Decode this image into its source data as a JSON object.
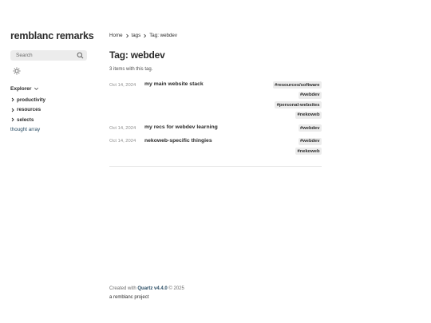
{
  "site": {
    "title": "remblanc remarks"
  },
  "search": {
    "placeholder": "Search"
  },
  "explorer": {
    "title": "Explorer",
    "items": [
      {
        "label": "productivity",
        "type": "folder"
      },
      {
        "label": "resources",
        "type": "folder"
      },
      {
        "label": "selects",
        "type": "folder"
      },
      {
        "label": "thought array",
        "type": "file"
      }
    ]
  },
  "breadcrumb": {
    "home": "Home",
    "tags": "tags",
    "current": "Tag: webdev"
  },
  "page": {
    "title": "Tag: webdev",
    "count_text": "3 items with this tag."
  },
  "posts": [
    {
      "date": "Oct 14, 2024",
      "title": "my main website stack",
      "tags": [
        "#resources/software",
        "#webdev",
        "#personal-websites",
        "#nekoweb"
      ]
    },
    {
      "date": "Oct 14, 2024",
      "title": "my recs for webdev learning",
      "tags": [
        "#webdev"
      ]
    },
    {
      "date": "Oct 14, 2024",
      "title": "nekoweb-specific thingies",
      "tags": [
        "#webdev",
        "#nekoweb"
      ]
    }
  ],
  "footer": {
    "created_prefix": "Created with",
    "quartz": "Quartz v4.4.0",
    "year": "© 2025",
    "project": "a remblanc project"
  },
  "icons": {
    "search": "search-icon",
    "theme": "sun-icon",
    "explorer": "chevron-down-icon",
    "folder": "chevron-right-icon",
    "breadcrumb": "chevron-right-icon"
  },
  "colors": {
    "text": "#2b2b2b",
    "muted": "#8e8e8e",
    "tag_bg": "#ececec",
    "link": "#284b63"
  }
}
